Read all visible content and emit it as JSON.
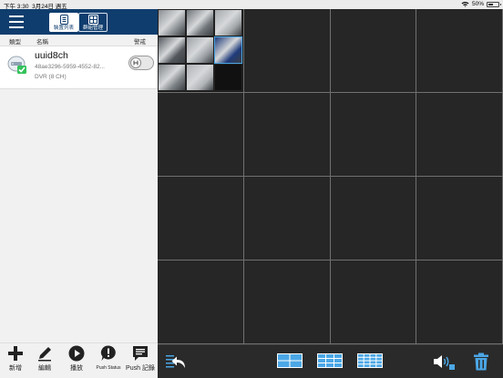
{
  "status_bar": {
    "time": "下午 3:30",
    "date": "3月24日 週五",
    "battery": "50%",
    "battery_level": 0.5
  },
  "sidebar": {
    "tabs": [
      {
        "label": "裝置列表",
        "icon": "device-list-icon",
        "active": true
      },
      {
        "label": "群組管理",
        "icon": "group-grid-icon",
        "active": false
      }
    ],
    "columns": {
      "type": "類型",
      "name": "名稱",
      "alarm": "警戒"
    },
    "device": {
      "name": "uuid8ch",
      "id": "48ae3296-5959-4552-82...",
      "type": "DVR (8 CH)",
      "alarm_enabled": false,
      "status_color": "#33c25a"
    },
    "bottom_bar": [
      {
        "label": "新增",
        "icon": "plus-icon"
      },
      {
        "label": "編輯",
        "icon": "pencil-icon"
      },
      {
        "label": "播放",
        "icon": "play-icon"
      },
      {
        "label": "Push Status",
        "icon": "push-alert-icon"
      },
      {
        "label": "Push 記錄",
        "icon": "message-icon"
      }
    ]
  },
  "video_grid": {
    "rows": 4,
    "cols": 4,
    "active_cell_thumbnail": "uuid8ch 8-channel preview"
  },
  "video_toolbar": {
    "items": [
      "back-icon",
      "layout-2x2-icon",
      "layout-3x3-icon",
      "layout-4x4-icon",
      "audio-icon",
      "trash-icon"
    ],
    "accent": "#4ba7e6"
  },
  "colors": {
    "nav_bar": "#0f3d6e",
    "sidebar_bg": "#f1f1f1",
    "grid_bg": "#262626",
    "grid_line": "#707070"
  }
}
